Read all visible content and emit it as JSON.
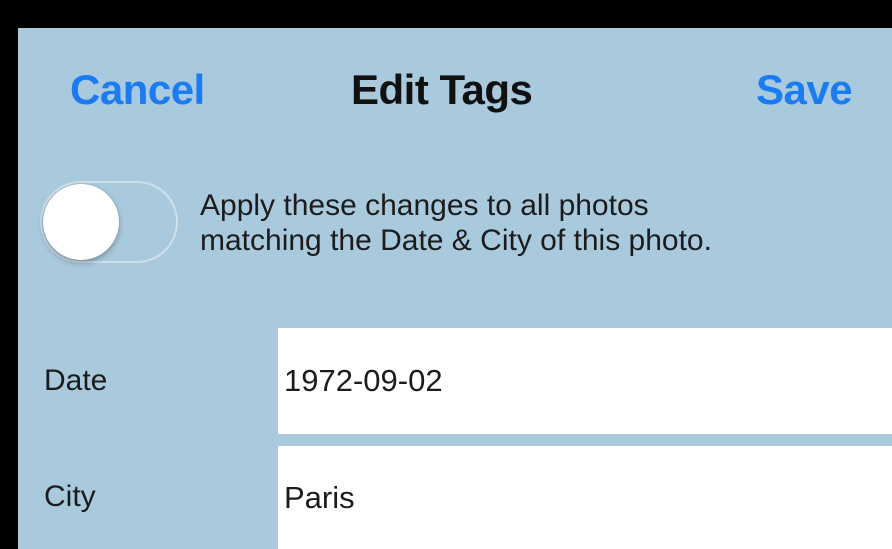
{
  "nav": {
    "cancel_label": "Cancel",
    "title": "Edit Tags",
    "save_label": "Save"
  },
  "apply_toggle": {
    "state": "off",
    "description_line1": "Apply these changes to all photos",
    "description_line2": "matching the Date & City of this photo."
  },
  "fields": {
    "date": {
      "label": "Date",
      "value": "1972-09-02"
    },
    "city": {
      "label": "City",
      "value": "Paris"
    }
  },
  "colors": {
    "background": "#a9c9dc",
    "accent": "#1a7cf5",
    "frame": "#000000"
  }
}
